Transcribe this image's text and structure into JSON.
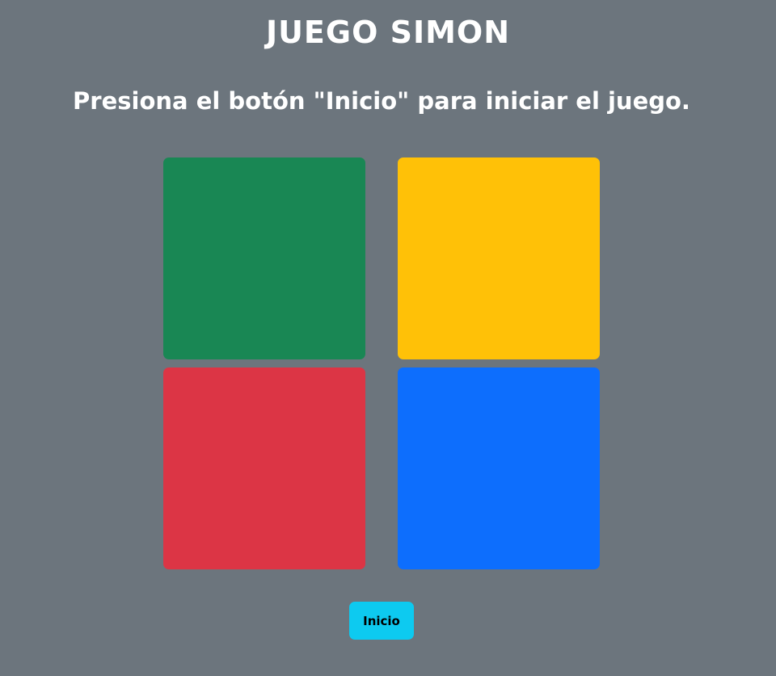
{
  "header": {
    "title": "JUEGO SIMON",
    "instructions": "Presiona el botón \"Inicio\" para iniciar el juego."
  },
  "board": {
    "pads": [
      {
        "name": "green",
        "color": "#198754"
      },
      {
        "name": "yellow",
        "color": "#ffc107"
      },
      {
        "name": "red",
        "color": "#dc3545"
      },
      {
        "name": "blue",
        "color": "#0d6efd"
      }
    ]
  },
  "controls": {
    "start_label": "Inicio",
    "start_color": "#0dcaf0"
  },
  "page": {
    "background": "#6c757d"
  }
}
